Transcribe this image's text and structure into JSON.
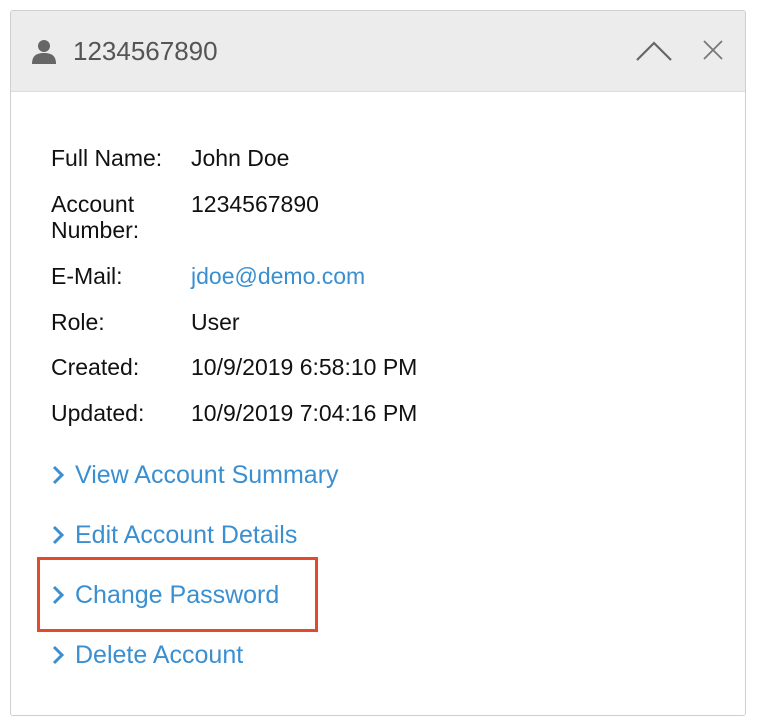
{
  "header": {
    "title": "1234567890",
    "icons": {
      "user": "user-icon",
      "collapse": "chevron-up-icon",
      "close": "close-icon"
    }
  },
  "details": {
    "full_name": {
      "label": "Full Name:",
      "value": "John Doe"
    },
    "account_number": {
      "label_line1": "Account",
      "label_line2": "Number:",
      "value": "1234567890"
    },
    "email": {
      "label": "E-Mail:",
      "value": "jdoe@demo.com"
    },
    "role": {
      "label": "Role:",
      "value": "User"
    },
    "created": {
      "label": "Created:",
      "value": "10/9/2019 6:58:10 PM"
    },
    "updated": {
      "label": "Updated:",
      "value": "10/9/2019 7:04:16 PM"
    }
  },
  "actions": [
    {
      "label": "View Account Summary"
    },
    {
      "label": "Edit Account Details"
    },
    {
      "label": "Change Password"
    },
    {
      "label": "Delete Account"
    }
  ],
  "colors": {
    "link": "#3a8fd1",
    "header_bg": "#ececec",
    "highlight": "#e2492f"
  }
}
